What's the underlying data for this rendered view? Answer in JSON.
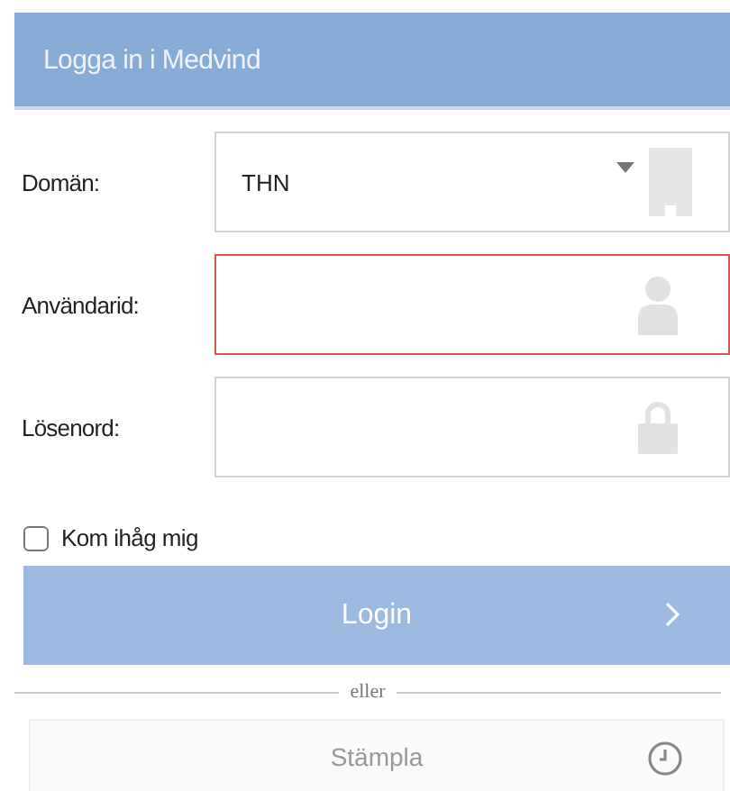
{
  "header": {
    "title": "Logga in i Medvind"
  },
  "fields": [
    {
      "kind": "select",
      "label": "Domän:",
      "value": "THN",
      "invalid": false
    },
    {
      "kind": "user",
      "label": "Användarid:",
      "invalid": true
    },
    {
      "kind": "password",
      "label": "Lösenord:",
      "invalid": false
    }
  ],
  "remember": {
    "label": "Kom ihåg mig",
    "checked": false
  },
  "login_button": {
    "label": "Login",
    "disabled": true
  },
  "divider": {
    "label": "eller"
  },
  "stamp_button": {
    "label": "Stämpla"
  }
}
